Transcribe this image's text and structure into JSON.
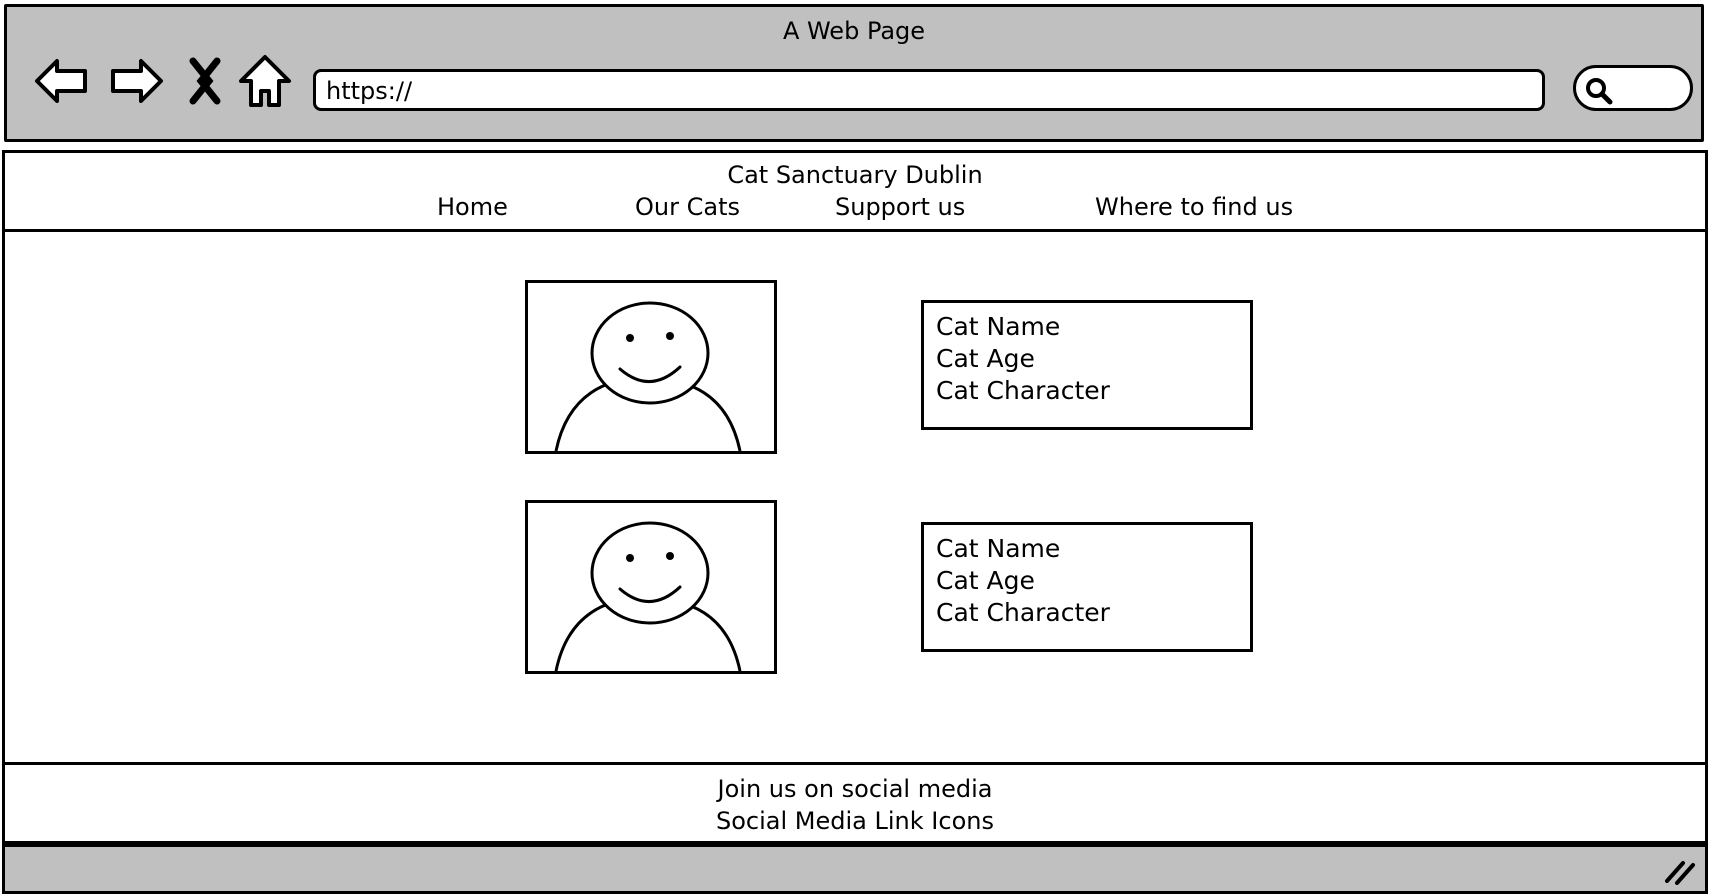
{
  "window": {
    "title": "A Web Page",
    "url": "https://"
  },
  "toolbar": {
    "icons": [
      "back-arrow-icon",
      "forward-arrow-icon",
      "close-x-icon",
      "home-icon",
      "search-icon",
      "resize-grip-icon"
    ]
  },
  "header": {
    "site_title": "Cat Sanctuary Dublin",
    "nav": [
      {
        "label": "Home"
      },
      {
        "label": "Our Cats"
      },
      {
        "label": "Support us"
      },
      {
        "label": "Where to find us"
      }
    ]
  },
  "cats": [
    {
      "name": "Cat Name",
      "age": "Cat Age",
      "character": "Cat Character",
      "photo_icon": "person-placeholder-icon"
    },
    {
      "name": "Cat Name",
      "age": "Cat Age",
      "character": "Cat Character",
      "photo_icon": "person-placeholder-icon"
    }
  ],
  "footer": {
    "line1": "Join us on social media",
    "line2": "Social Media Link Icons"
  }
}
